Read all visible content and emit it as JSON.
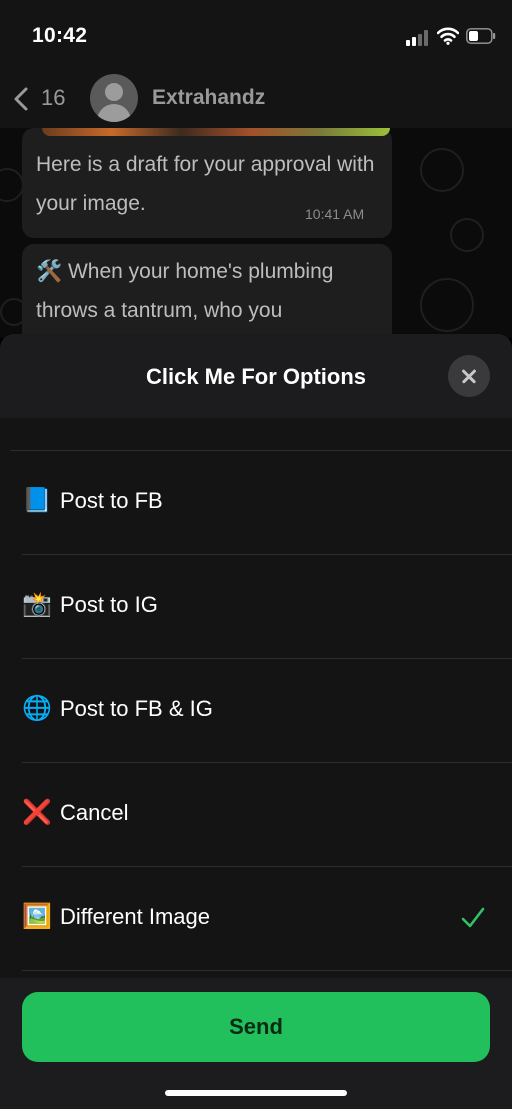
{
  "status_bar": {
    "time": "10:42"
  },
  "header": {
    "back_count": "16",
    "contact_name": "Extrahandz"
  },
  "chat": {
    "messages": [
      {
        "text": "Here is a draft for your approval with your image.",
        "time": "10:41 AM"
      },
      {
        "text": "🛠️ When your home's plumbing throws a tantrum, who you"
      }
    ]
  },
  "sheet": {
    "title": "Click Me For Options",
    "options": [
      {
        "emoji": "📘",
        "label": "Post to FB",
        "selected": false
      },
      {
        "emoji": "📸",
        "label": "Post to IG",
        "selected": false
      },
      {
        "emoji": "🌐",
        "label": "Post to FB & IG",
        "selected": false
      },
      {
        "emoji": "❌",
        "label": "Cancel",
        "selected": false
      },
      {
        "emoji": "🖼️",
        "label": "Different Image",
        "selected": true
      }
    ],
    "send_label": "Send"
  },
  "colors": {
    "accent_green": "#22c05c",
    "check_green": "#30c368",
    "sheet_bg": "#1c1c1e"
  }
}
